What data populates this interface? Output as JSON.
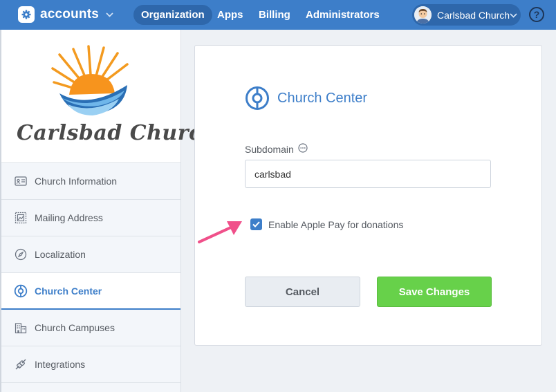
{
  "topbar": {
    "brand": "accounts",
    "nav": [
      {
        "label": "Organization",
        "active": true
      },
      {
        "label": "Apps",
        "active": false
      },
      {
        "label": "Billing",
        "active": false
      },
      {
        "label": "Administrators",
        "active": false
      }
    ],
    "user_name": "Carlsbad Church",
    "help_label": "?"
  },
  "sidebar": {
    "logo_text": "Carlsbad Church",
    "items": [
      {
        "label": "Church Information",
        "icon": "id-card-icon"
      },
      {
        "label": "Mailing Address",
        "icon": "stamp-icon"
      },
      {
        "label": "Localization",
        "icon": "compass-icon"
      },
      {
        "label": "Church Center",
        "icon": "church-center-icon",
        "active": true
      },
      {
        "label": "Church Campuses",
        "icon": "buildings-icon"
      },
      {
        "label": "Integrations",
        "icon": "plug-icon"
      }
    ]
  },
  "card": {
    "title": "Church Center",
    "subdomain_label": "Subdomain",
    "subdomain_value": "carlsbad",
    "apple_pay_label": "Enable Apple Pay for donations",
    "apple_pay_checked": true,
    "cancel_label": "Cancel",
    "save_label": "Save Changes"
  },
  "colors": {
    "topbar": "#3d7ec9",
    "accent": "#3d7ec9",
    "save": "#67d14a",
    "arrow": "#f0508a"
  }
}
